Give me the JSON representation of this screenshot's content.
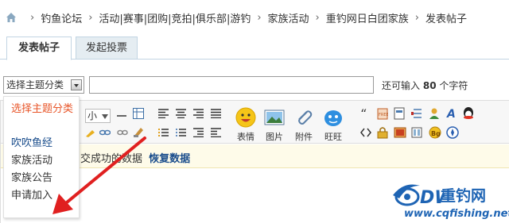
{
  "breadcrumb": {
    "items": [
      "钓鱼论坛",
      "活动|赛事|团购|竞拍|俱乐部|游钓",
      "家族活动",
      "重钓网日白团家族",
      "发表帖子"
    ],
    "separator": "›"
  },
  "tabs": [
    {
      "label": "发表帖子",
      "active": true
    },
    {
      "label": "发起投票",
      "active": false
    }
  ],
  "subject": {
    "type_select_value": "选择主题分类",
    "input_value": "",
    "hint_prefix": "还可输入",
    "hint_count": "80",
    "hint_suffix": "个字符"
  },
  "editor": {
    "font_size_value": "小",
    "buttons": {
      "emoji": "表情",
      "image": "图片",
      "attachment": "附件",
      "wangwang": "旺旺"
    },
    "notice_text": "交成功的数据",
    "restore_label": "恢复数据"
  },
  "dropdown": {
    "items": [
      "选择主题分类",
      "吹吹鱼经",
      "家族活动",
      "家族公告",
      "申请加入"
    ]
  },
  "watermark": {
    "brand": "重钓网",
    "logo_letters": "DW",
    "url": "www.cqfishing.net"
  },
  "colors": {
    "accent_orange": "#e8562a",
    "link_blue": "#1a4d8c",
    "arrow_red": "#e02020",
    "watermark_blue": "#1e64b4"
  }
}
